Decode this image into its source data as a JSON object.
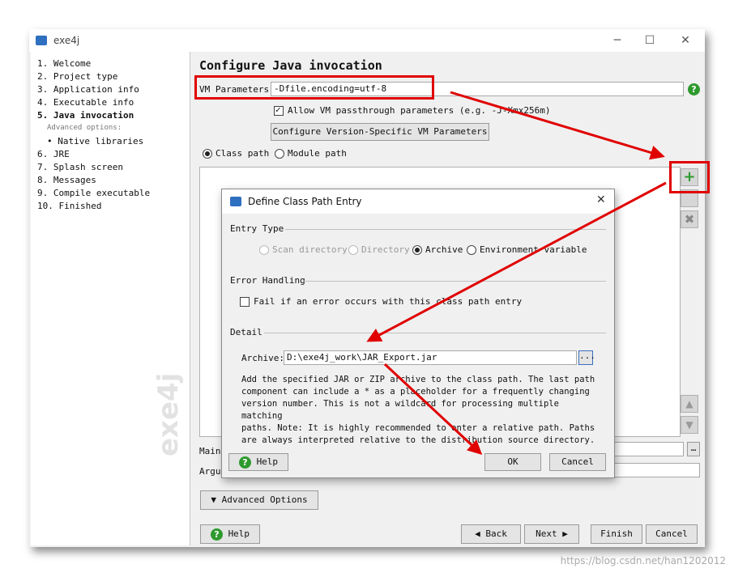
{
  "window": {
    "title": "exe4j"
  },
  "steps": [
    {
      "label": "1. Welcome"
    },
    {
      "label": "2. Project type"
    },
    {
      "label": "3. Application info"
    },
    {
      "label": "4. Executable info"
    },
    {
      "label": "5. Java invocation",
      "active": true
    },
    {
      "label": "Advanced options:"
    },
    {
      "label": "• Native libraries"
    },
    {
      "label": "6. JRE"
    },
    {
      "label": "7. Splash screen"
    },
    {
      "label": "8. Messages"
    },
    {
      "label": "9. Compile executable"
    },
    {
      "label": "10. Finished"
    }
  ],
  "watermark": "exe4j",
  "main": {
    "title": "Configure Java invocation",
    "vm_label": "VM Parameters:",
    "vm_value": "-Dfile.encoding=utf-8",
    "passthrough_label": "Allow VM passthrough parameters (e.g. -J-Xmx256m)",
    "passthrough_checked": true,
    "version_btn": "Configure Version-Specific VM Parameters",
    "classpath_radio": "Class path",
    "modulepath_radio": "Module path",
    "main_label": "Main",
    "args_label": "Argum",
    "advanced_btn": "Advanced Options",
    "help_btn": "Help",
    "back_btn": "Back",
    "next_btn": "Next",
    "finish_btn": "Finish",
    "cancel_btn": "Cancel"
  },
  "dialog": {
    "title": "Define Class Path Entry",
    "entry_type_label": "Entry Type",
    "entry_types": [
      "Scan directory",
      "Directory",
      "Archive",
      "Environment variable"
    ],
    "selected_entry_type": "Archive",
    "error_handling_label": "Error Handling",
    "fail_label": "Fail if an error occurs with this class path entry",
    "detail_label": "Detail",
    "archive_label": "Archive:",
    "archive_value": "D:\\exe4j_work\\JAR_Export.jar",
    "browse_label": "...",
    "description": [
      "Add the specified JAR or ZIP archive to the class path. The last path",
      "component can include a * as a placeholder for a frequently changing",
      "version number. This is not a wildcard for processing multiple matching",
      "paths. Note: It is highly recommended to enter a relative path. Paths",
      "are always interpreted relative to the distribution source directory."
    ],
    "help_btn": "Help",
    "ok_btn": "OK",
    "cancel_btn": "Cancel"
  },
  "credit": "https://blog.csdn.net/han1202012",
  "colors": {
    "annotation": "#e00000",
    "help_green": "#2e9a2e",
    "add_green": "#2c9a2c"
  }
}
